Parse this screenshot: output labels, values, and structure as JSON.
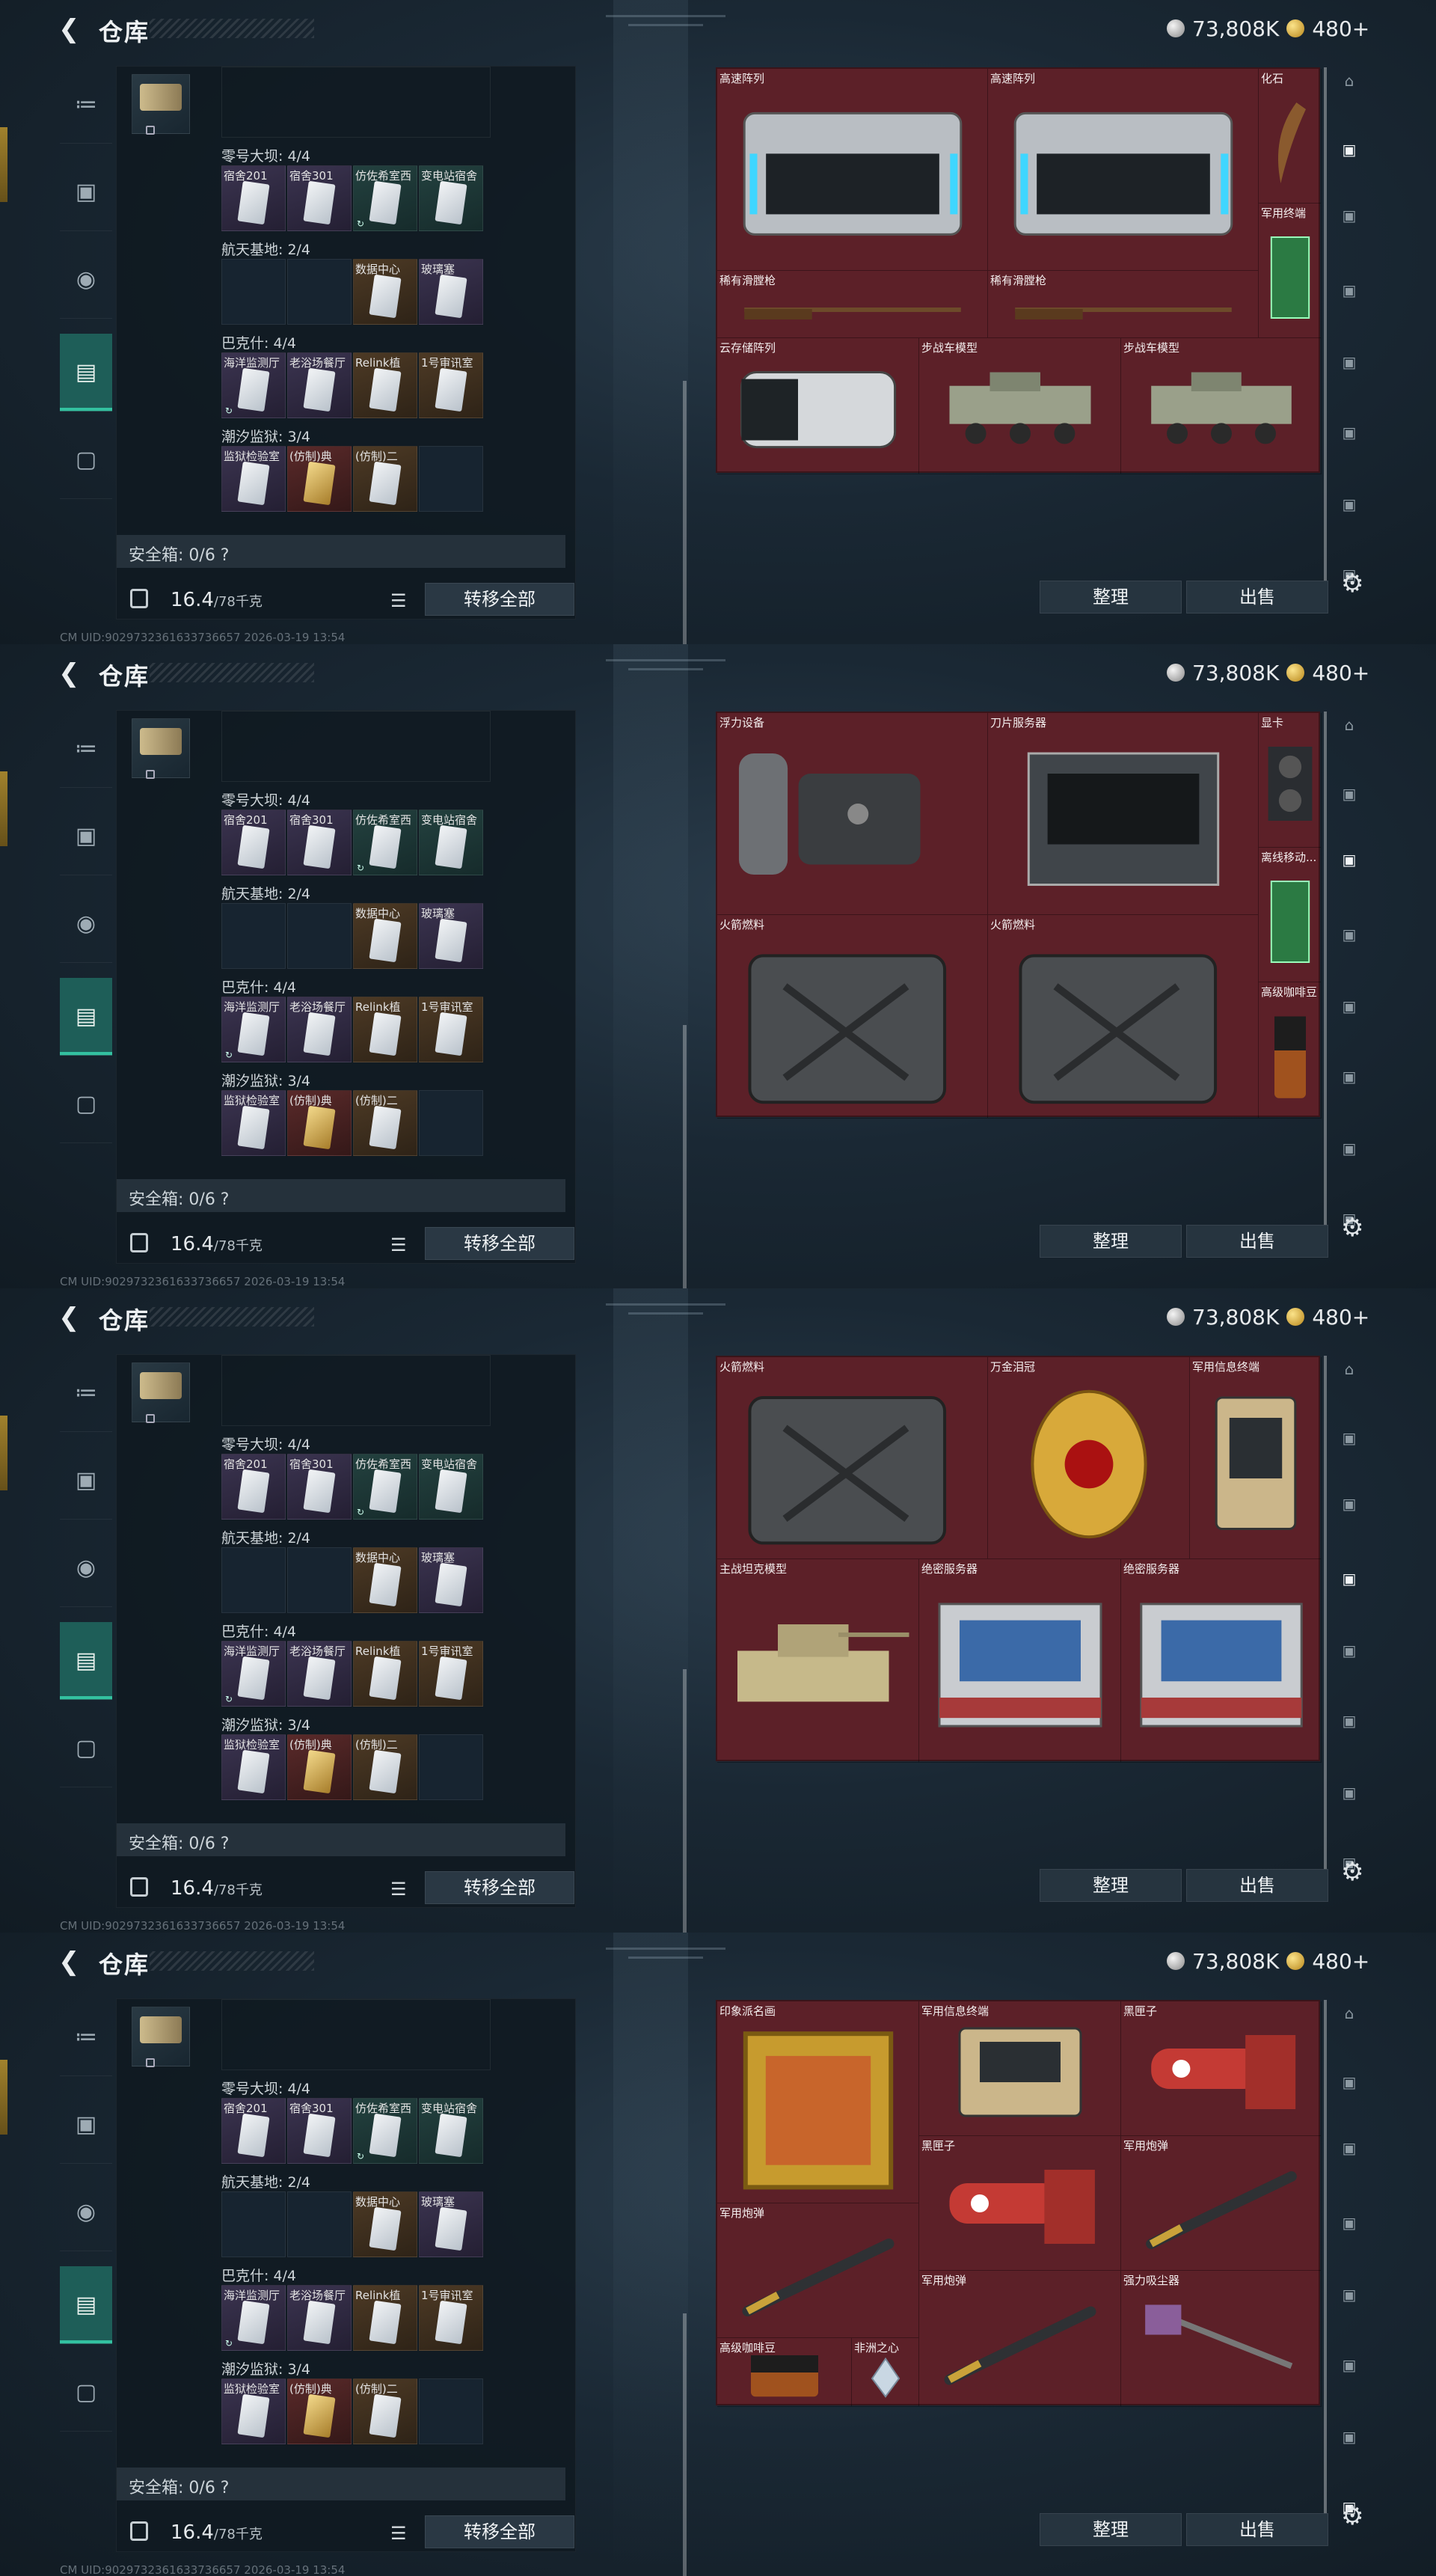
{
  "header": {
    "title": "仓库",
    "silver": "73,808K",
    "gold": "480+"
  },
  "stash": {
    "categories": [
      {
        "name": "零号大坝: 4/4",
        "items": [
          {
            "label": "宿舍201",
            "color": "purple",
            "paper": "plain"
          },
          {
            "label": "宿舍301",
            "color": "purple",
            "paper": "plain"
          },
          {
            "label": "仿佐希室西",
            "color": "teal",
            "paper": "plain",
            "spin": true
          },
          {
            "label": "变电站宿舍",
            "color": "teal",
            "paper": "plain"
          }
        ]
      },
      {
        "name": "航天基地: 2/4",
        "items": [
          {
            "label": "",
            "color": "empty"
          },
          {
            "label": "",
            "color": "empty"
          },
          {
            "label": "数据中心",
            "color": "brown",
            "paper": "plain"
          },
          {
            "label": "玻璃塞",
            "color": "purple",
            "paper": "plain"
          }
        ]
      },
      {
        "name": "巴克什: 4/4",
        "items": [
          {
            "label": "海洋监测厅",
            "color": "purple",
            "paper": "plain",
            "spin": true
          },
          {
            "label": "老浴场餐厅",
            "color": "purple",
            "paper": "plain"
          },
          {
            "label": "Relink植",
            "color": "brown",
            "paper": "plain"
          },
          {
            "label": "1号审讯室",
            "color": "brown",
            "paper": "plain"
          }
        ]
      },
      {
        "name": "潮汐监狱: 3/4",
        "items": [
          {
            "label": "监狱检验室",
            "color": "purple",
            "paper": "plain"
          },
          {
            "label": "(仿制)典",
            "color": "red",
            "paper": "gold"
          },
          {
            "label": "(仿制)二",
            "color": "brown",
            "paper": "plain"
          },
          {
            "label": "",
            "color": "empty"
          }
        ]
      }
    ],
    "safebox": "安全箱: 0/6 ?",
    "weight": "16.4",
    "weight_max": "/78千克",
    "transfer_all": "转移全部"
  },
  "actions": {
    "sort": "整理",
    "sell": "出售"
  },
  "uid": "CM UID:9029732361633736657 2026-03-19 13:54",
  "screens": [
    {
      "items": [
        {
          "name": "高速阵列",
          "icon": "server-array"
        },
        {
          "name": "高速阵列",
          "icon": "server-array"
        },
        {
          "name": "化石",
          "icon": "fossil-claw"
        },
        {
          "name": "军用终端",
          "icon": "green-board"
        },
        {
          "name": "稀有滑膛枪",
          "icon": "musket"
        },
        {
          "name": "稀有滑膛枪",
          "icon": "musket"
        },
        {
          "name": "云存储阵列",
          "icon": "cloud-storage"
        },
        {
          "name": "步战车模型",
          "icon": "ifv-model"
        },
        {
          "name": "步战车模型",
          "icon": "ifv-model"
        }
      ]
    },
    {
      "items": [
        {
          "name": "浮力设备",
          "icon": "buoyancy-device"
        },
        {
          "name": "刀片服务器",
          "icon": "blade-server"
        },
        {
          "name": "显卡",
          "icon": "gpu"
        },
        {
          "name": "离线移动...",
          "icon": "green-board"
        },
        {
          "name": "火箭燃料",
          "icon": "fuel-can"
        },
        {
          "name": "火箭燃料",
          "icon": "fuel-can"
        },
        {
          "name": "高级咖啡豆",
          "icon": "coffee-bag"
        }
      ]
    },
    {
      "items": [
        {
          "name": "火箭燃料",
          "icon": "fuel-can"
        },
        {
          "name": "万金泪冠",
          "icon": "golden-egg"
        },
        {
          "name": "军用信息终端",
          "icon": "field-terminal"
        },
        {
          "name": "主战坦克模型",
          "icon": "tank-model"
        },
        {
          "name": "绝密服务器",
          "icon": "rack-server"
        },
        {
          "name": "绝密服务器",
          "icon": "rack-server"
        }
      ]
    },
    {
      "items": [
        {
          "name": "印象派名画",
          "icon": "painting"
        },
        {
          "name": "军用信息终端",
          "icon": "field-terminal"
        },
        {
          "name": "黑匣子",
          "icon": "black-box"
        },
        {
          "name": "黑匣子",
          "icon": "black-box"
        },
        {
          "name": "军用炮弹",
          "icon": "missile"
        },
        {
          "name": "军用炮弹",
          "icon": "missile"
        },
        {
          "name": "军用炮弹",
          "icon": "missile"
        },
        {
          "name": "强力吸尘器",
          "icon": "vacuum"
        },
        {
          "name": "高级咖啡豆",
          "icon": "coffee-bag"
        },
        {
          "name": "非洲之心",
          "icon": "diamond"
        }
      ]
    }
  ]
}
